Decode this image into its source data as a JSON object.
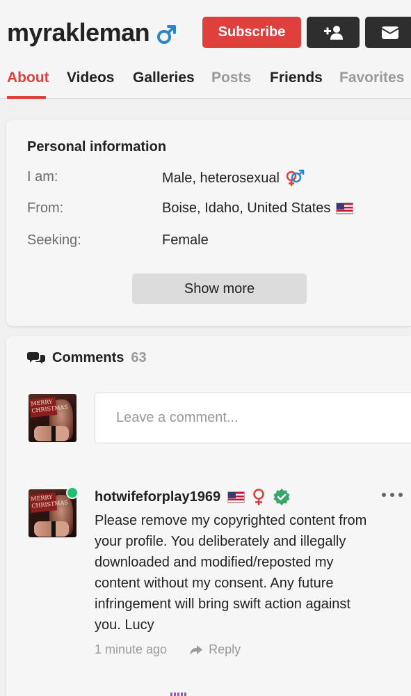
{
  "profile": {
    "username": "myrakleman",
    "gender_icon": "male-symbol-icon"
  },
  "actions": {
    "subscribe_label": "Subscribe",
    "add_friend_icon": "user-plus-icon",
    "message_icon": "envelope-icon"
  },
  "tabs": [
    {
      "label": "About",
      "state": "active"
    },
    {
      "label": "Videos",
      "state": "normal"
    },
    {
      "label": "Galleries",
      "state": "normal"
    },
    {
      "label": "Posts",
      "state": "muted"
    },
    {
      "label": "Friends",
      "state": "normal"
    },
    {
      "label": "Favorites",
      "state": "muted"
    }
  ],
  "personal_info": {
    "title": "Personal information",
    "rows": [
      {
        "label": "I am:",
        "value": "Male, heterosexual",
        "icon": "hetero-symbol-icon"
      },
      {
        "label": "From:",
        "value": "Boise, Idaho, United States",
        "icon": "us-flag-icon"
      },
      {
        "label": "Seeking:",
        "value": "Female"
      }
    ],
    "show_more_label": "Show more"
  },
  "comments": {
    "title": "Comments",
    "count": "63",
    "input_placeholder": "Leave a comment...",
    "items": [
      {
        "author": "hotwifeforplay1969",
        "online": true,
        "flag_icon": "us-flag-icon",
        "gender_icon": "female-symbol-icon",
        "verified_icon": "verified-badge-icon",
        "text": "Please remove my copyrighted content from your profile.  You deliberately and illegally downloaded and modified/reposted my content without my consent.  Any future infringement will bring swift action against you. Lucy",
        "time": "1 minute ago",
        "reply_label": "Reply"
      }
    ]
  },
  "colors": {
    "accent": "#e0403c",
    "dark_button": "#2e2e2e",
    "male_blue": "#2b86c5",
    "female_red": "#e0403c",
    "online_green": "#1fbf72",
    "verified_green": "#3aa56a"
  }
}
